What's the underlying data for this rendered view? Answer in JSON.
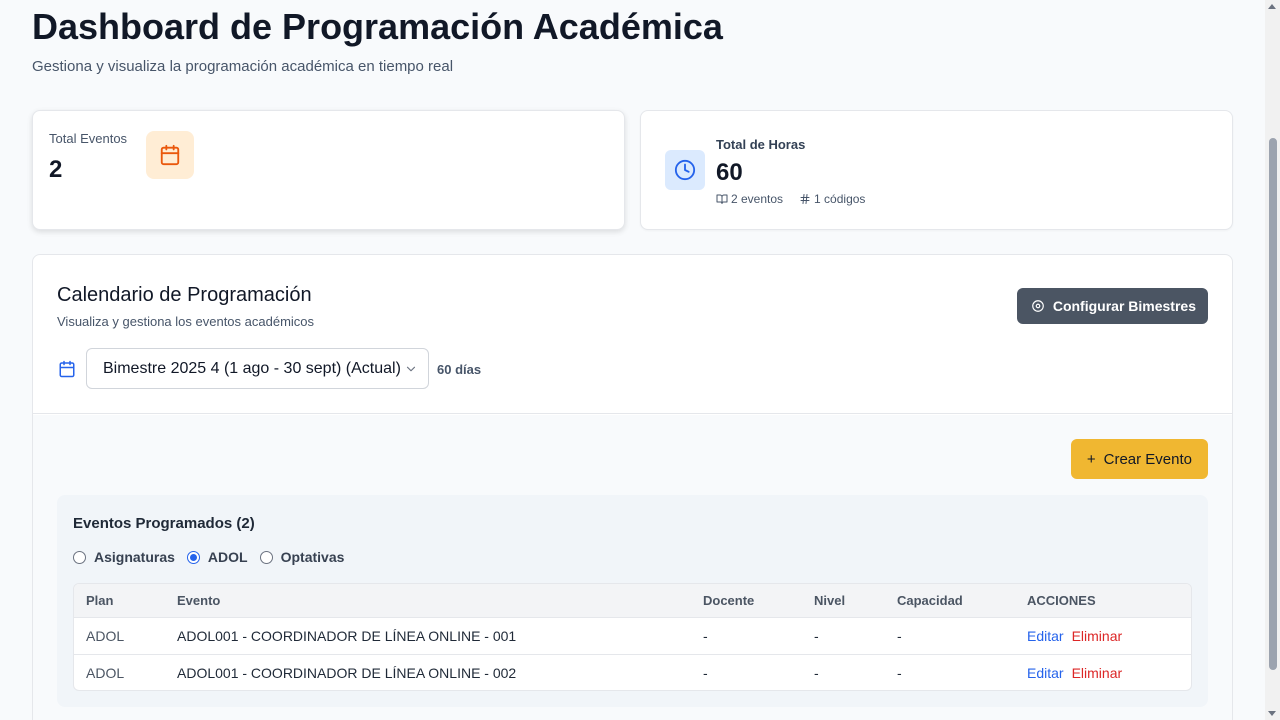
{
  "header": {
    "title": "Dashboard de Programación Académica",
    "subtitle": "Gestiona y visualiza la programación académica en tiempo real"
  },
  "stats": {
    "events": {
      "label": "Total Eventos",
      "value": "2",
      "icon": "calendar-icon"
    },
    "hours": {
      "label": "Total de Horas",
      "value": "60",
      "icon": "clock-icon",
      "events_count": "2 eventos",
      "codes_count": "1 códigos"
    }
  },
  "calendar": {
    "title": "Calendario de Programación",
    "subtitle": "Visualiza y gestiona los eventos académicos",
    "config_button": "Configurar Bimestres",
    "period_selected": "Bimestre 2025 4 (1 ago - 30 sept) (Actual)",
    "period_days": "60 días",
    "create_button": "Crear Evento",
    "create_button_icon": "+"
  },
  "events": {
    "title": "Eventos Programados (2)",
    "filters": [
      {
        "label": "Asignaturas",
        "checked": false
      },
      {
        "label": "ADOL",
        "checked": true
      },
      {
        "label": "Optativas",
        "checked": false
      }
    ],
    "columns": [
      "Plan",
      "Evento",
      "Docente",
      "Nivel",
      "Capacidad",
      "ACCIONES"
    ],
    "rows": [
      {
        "plan": "ADOL",
        "evento": "ADOL001 - COORDINADOR DE LÍNEA ONLINE - 001",
        "docente": "-",
        "nivel": "-",
        "capacidad": "-",
        "edit": "Editar",
        "delete": "Eliminar"
      },
      {
        "plan": "ADOL",
        "evento": "ADOL001 - COORDINADOR DE LÍNEA ONLINE - 002",
        "docente": "-",
        "nivel": "-",
        "capacidad": "-",
        "edit": "Editar",
        "delete": "Eliminar"
      }
    ]
  },
  "colors": {
    "accent_yellow": "#f0b731",
    "config_button": "#4b5563",
    "link_blue": "#2563eb",
    "delete_red": "#dc2626"
  }
}
